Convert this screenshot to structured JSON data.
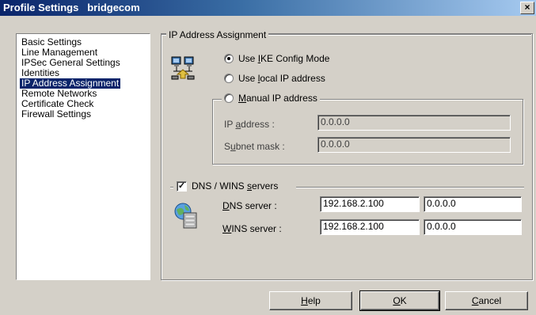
{
  "window": {
    "title": "Profile Settings",
    "profile_name": "bridgecom",
    "close_glyph": "×"
  },
  "sidebar": {
    "items": [
      {
        "label": "Basic Settings",
        "selected": false
      },
      {
        "label": "Line Management",
        "selected": false
      },
      {
        "label": "IPSec General Settings",
        "selected": false
      },
      {
        "label": "Identities",
        "selected": false
      },
      {
        "label": "IP Address Assignment",
        "selected": true
      },
      {
        "label": "Remote Networks",
        "selected": false
      },
      {
        "label": "Certificate Check",
        "selected": false
      },
      {
        "label": "Firewall Settings",
        "selected": false
      }
    ]
  },
  "ip_assignment": {
    "group_title": "IP Address Assignment",
    "icon": "network-computers-icon",
    "options": {
      "ike_pre": "Use ",
      "ike_key": "I",
      "ike_post": "KE Config Mode",
      "local_pre": "Use ",
      "local_key": "l",
      "local_post": "ocal IP address",
      "manual_pre": "",
      "manual_key": "M",
      "manual_post": "anual IP address"
    },
    "selected_option": "ike",
    "manual": {
      "ip_label_pre": "IP ",
      "ip_label_key": "a",
      "ip_label_post": "ddress :",
      "ip_value": "0.0.0.0",
      "mask_label_pre": "S",
      "mask_label_key": "u",
      "mask_label_post": "bnet mask :",
      "mask_value": "0.0.0.0"
    }
  },
  "dns_wins": {
    "checkbox_pre": "DNS / WINS ",
    "checkbox_key": "s",
    "checkbox_post": "ervers",
    "checked": true,
    "check_glyph": "✓",
    "icon": "server-globe-icon",
    "dns_label_key": "D",
    "dns_label_post": "NS server :",
    "wins_label_key": "W",
    "wins_label_post": "INS server :",
    "dns_primary": "192.168.2.100",
    "dns_secondary": "0.0.0.0",
    "wins_primary": "192.168.2.100",
    "wins_secondary": "0.0.0.0"
  },
  "buttons": {
    "help_key": "H",
    "help_post": "elp",
    "ok_key": "O",
    "ok_post": "K",
    "cancel_key": "C",
    "cancel_post": "ancel"
  }
}
